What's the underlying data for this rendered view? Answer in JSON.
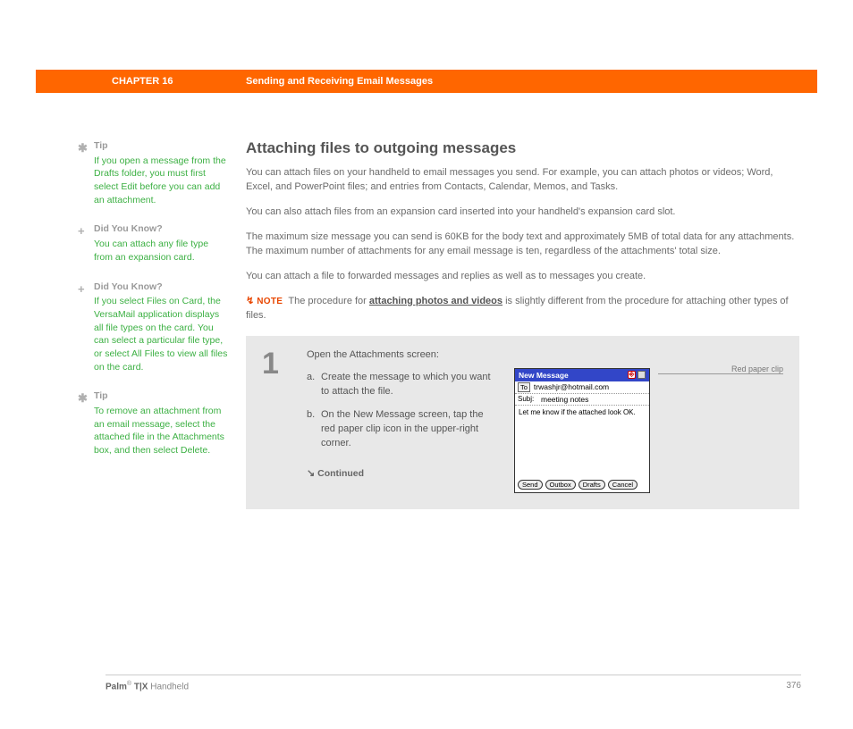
{
  "header": {
    "chapter": "CHAPTER 16",
    "title": "Sending and Receiving Email Messages"
  },
  "sidebar": [
    {
      "icon": "✱",
      "head": "Tip",
      "body": "If you open a message from the Drafts folder, you must first select Edit before you can add an attachment."
    },
    {
      "icon": "+",
      "head": "Did You Know?",
      "body": "You can attach any file type from an expansion card."
    },
    {
      "icon": "+",
      "head": "Did You Know?",
      "body": "If you select Files on Card, the VersaMail application displays all file types on the card. You can select a particular file type, or select All Files to view all files on the card."
    },
    {
      "icon": "✱",
      "head": "Tip",
      "body": "To remove an attachment from an email message, select the attached file in the Attachments box, and then select Delete."
    }
  ],
  "main": {
    "heading": "Attaching files to outgoing messages",
    "p1": "You can attach files on your handheld to email messages you send. For example, you can attach photos or videos; Word, Excel, and PowerPoint files; and entries from Contacts, Calendar, Memos, and Tasks.",
    "p2": "You can also attach files from an expansion card inserted into your handheld's expansion card slot.",
    "p3": "The maximum size message you can send is 60KB for the body text and approximately 5MB of total data for any attachments. The maximum number of attachments for any email message is ten, regardless of the attachments' total size.",
    "p4": "You can attach a file to forwarded messages and replies as well as to messages you create.",
    "note": {
      "label": "NOTE",
      "pre": "The procedure for ",
      "link": "attaching photos and videos",
      "post": " is slightly different from the procedure for attaching other types of files."
    }
  },
  "step": {
    "num": "1",
    "lead": "Open the Attachments screen:",
    "a": "Create the message to which you want to attach the file.",
    "b": "On the New Message screen, tap the red paper clip icon in the upper-right corner.",
    "continued": "Continued"
  },
  "callout": "Red paper clip",
  "device": {
    "title": "New Message",
    "to_label": "To",
    "to_value": "trwashjr@hotmail.com",
    "subj_label": "Subj:",
    "subj_value": "meeting notes",
    "body": "Let me know if the attached look OK.",
    "btns": [
      "Send",
      "Outbox",
      "Drafts",
      "Cancel"
    ]
  },
  "footer": {
    "product_bold": "Palm",
    "reg": "®",
    "product_mid": " T|X ",
    "product_light": "Handheld",
    "page": "376"
  }
}
